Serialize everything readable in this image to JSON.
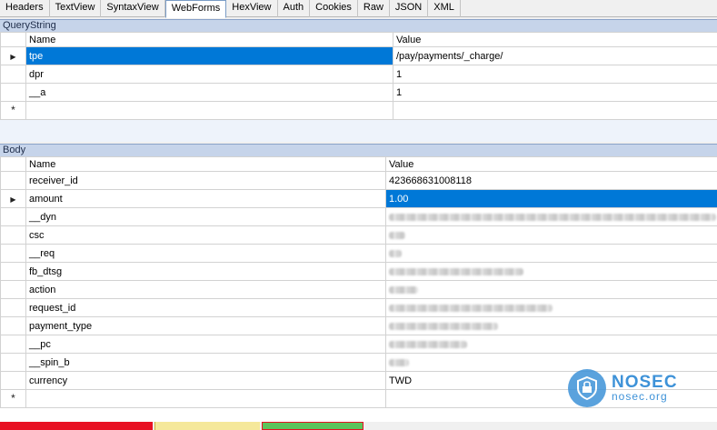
{
  "tabs": [
    "Headers",
    "TextView",
    "SyntaxView",
    "WebForms",
    "HexView",
    "Auth",
    "Cookies",
    "Raw",
    "JSON",
    "XML"
  ],
  "active_tab": "WebForms",
  "querystring": {
    "title": "QueryString",
    "col_name": "Name",
    "col_value": "Value",
    "rows": [
      {
        "name": "tpe",
        "value": "/pay/payments/_charge/"
      },
      {
        "name": "dpr",
        "value": "1"
      },
      {
        "name": "__a",
        "value": "1"
      }
    ]
  },
  "body": {
    "title": "Body",
    "col_name": "Name",
    "col_value": "Value",
    "rows": [
      {
        "name": "receiver_id",
        "value": "423668631008118"
      },
      {
        "name": "amount",
        "value": "1.00"
      },
      {
        "name": "__dyn",
        "value": ""
      },
      {
        "name": "csc",
        "value": ""
      },
      {
        "name": "__req",
        "value": ""
      },
      {
        "name": "fb_dtsg",
        "value": ""
      },
      {
        "name": "action",
        "value": ""
      },
      {
        "name": "request_id",
        "value": ""
      },
      {
        "name": "payment_type",
        "value": ""
      },
      {
        "name": "__pc",
        "value": ""
      },
      {
        "name": "__spin_b",
        "value": ""
      },
      {
        "name": "currency",
        "value": "TWD"
      }
    ]
  },
  "icons": {
    "row_pointer": "row-pointer-icon",
    "new_row": "new-row-star-icon",
    "logo": "nosec-shield-logo"
  },
  "watermark": {
    "name": "NOSEC",
    "site": "nosec.org"
  },
  "colors": {
    "selection": "#0078d7",
    "section_header": "#c6d4ea",
    "logo": "#3e92d8"
  }
}
